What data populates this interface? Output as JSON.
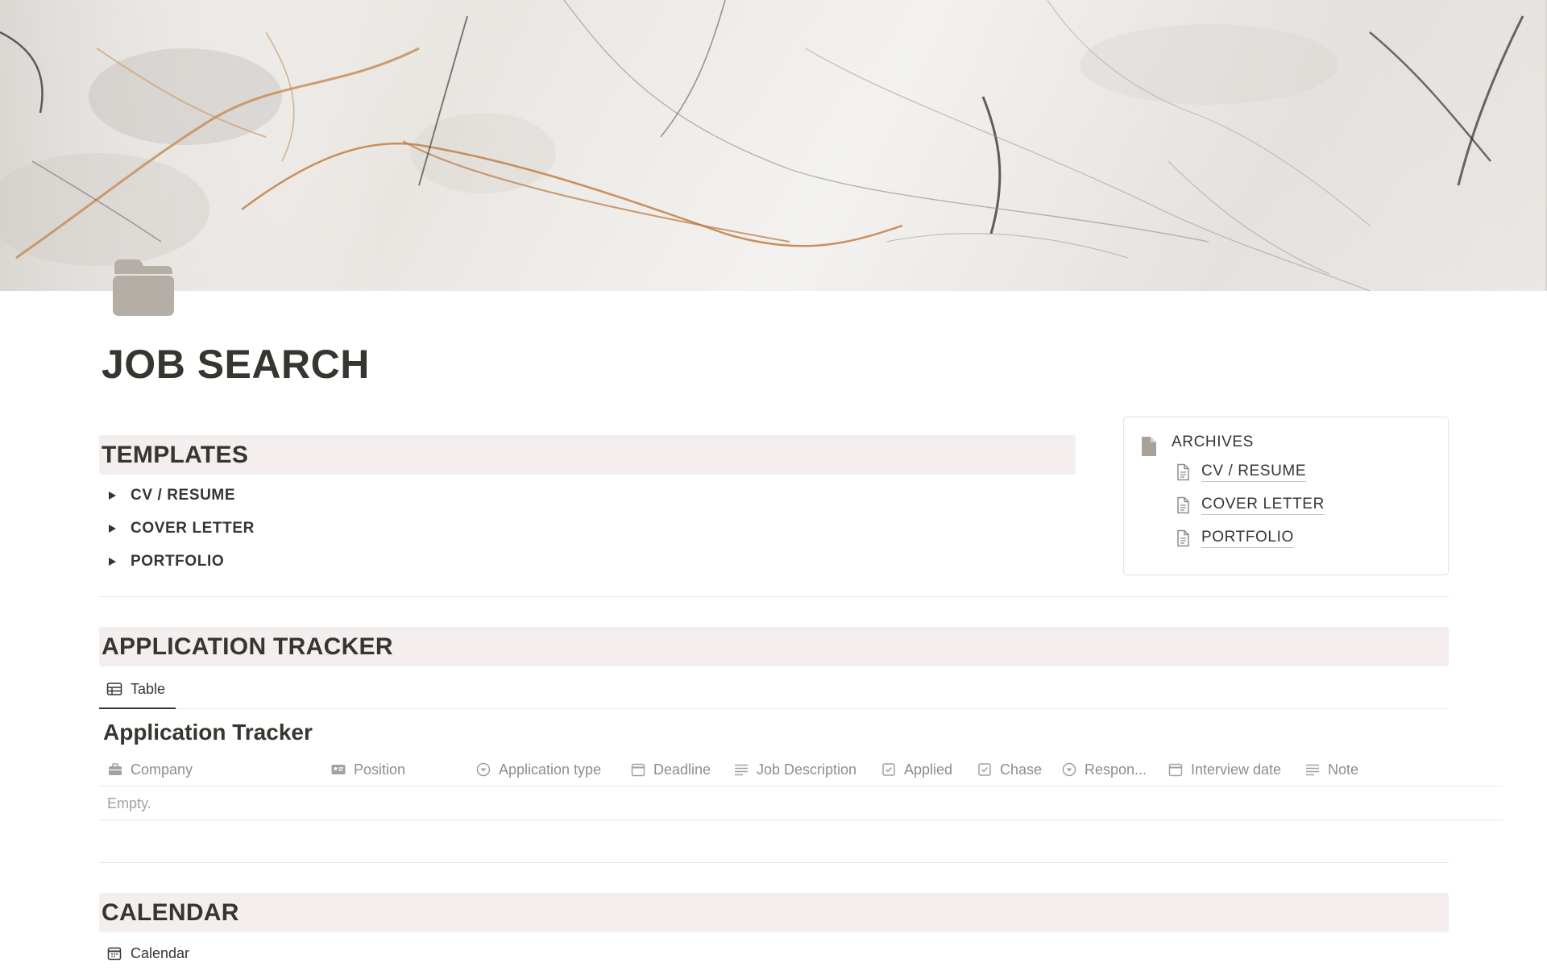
{
  "page": {
    "title": "JOB SEARCH",
    "icon": "folder-icon"
  },
  "templates": {
    "heading": "TEMPLATES",
    "items": [
      {
        "label": "CV / RESUME",
        "icon": "triangle-right-icon"
      },
      {
        "label": "COVER LETTER",
        "icon": "triangle-right-icon"
      },
      {
        "label": "PORTFOLIO",
        "icon": "triangle-right-icon"
      }
    ]
  },
  "archives": {
    "title": "ARCHIVES",
    "icon": "file-icon",
    "links": [
      {
        "label": "CV / RESUME",
        "icon": "document-icon"
      },
      {
        "label": "COVER LETTER",
        "icon": "document-icon"
      },
      {
        "label": "PORTFOLIO",
        "icon": "document-icon"
      }
    ]
  },
  "tracker": {
    "heading": "APPLICATION TRACKER",
    "view_tab": {
      "label": "Table",
      "icon": "table-icon"
    },
    "database_title": "Application Tracker",
    "columns": [
      {
        "label": "Company",
        "icon": "briefcase-icon"
      },
      {
        "label": "Position",
        "icon": "id-card-icon"
      },
      {
        "label": "Application type",
        "icon": "select-icon"
      },
      {
        "label": "Deadline",
        "icon": "calendar-icon"
      },
      {
        "label": "Job Description",
        "icon": "text-lines-icon"
      },
      {
        "label": "Applied",
        "icon": "checkbox-icon"
      },
      {
        "label": "Chase",
        "icon": "checkbox-icon"
      },
      {
        "label": "Respon...",
        "icon": "select-icon"
      },
      {
        "label": "Interview date",
        "icon": "calendar-icon"
      },
      {
        "label": "Note",
        "icon": "text-lines-icon"
      }
    ],
    "empty_text": "Empty."
  },
  "calendar": {
    "heading": "CALENDAR",
    "view_tab": {
      "label": "Calendar",
      "icon": "calendar-icon"
    }
  },
  "colors": {
    "text": "#37352f",
    "muted": "#8f8d89",
    "heading_bg": "#f4eeee",
    "icon_gray": "#a8a29a"
  }
}
